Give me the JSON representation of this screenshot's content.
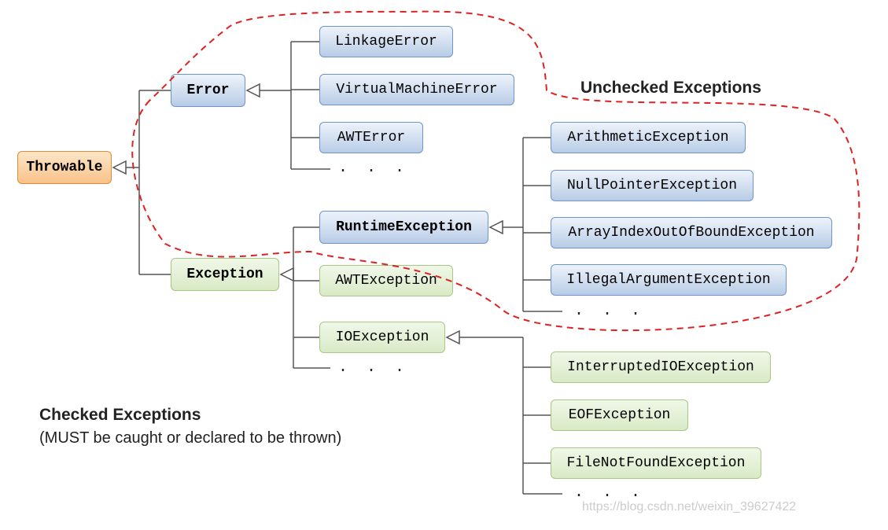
{
  "root": "Throwable",
  "error": {
    "label": "Error",
    "children": [
      "LinkageError",
      "VirtualMachineError",
      "AWTError"
    ],
    "ellipsis": ". . ."
  },
  "exception": {
    "label": "Exception",
    "runtime": {
      "label": "RuntimeException",
      "children": [
        "ArithmeticException",
        "NullPointerException",
        "ArrayIndexOutOfBoundException",
        "IllegalArgumentException"
      ],
      "ellipsis": ". . ."
    },
    "awt": "AWTException",
    "io": {
      "label": "IOException",
      "children": [
        "InterruptedIOException",
        "EOFException",
        "FileNotFoundException"
      ],
      "ellipsis": ". . ."
    },
    "ellipsis": ". . ."
  },
  "labels": {
    "unchecked": "Unchecked Exceptions",
    "checked_title": "Checked Exceptions",
    "checked_sub": "(MUST be caught or declared to be thrown)"
  },
  "watermark": "https://blog.csdn.net/weixin_39627422"
}
